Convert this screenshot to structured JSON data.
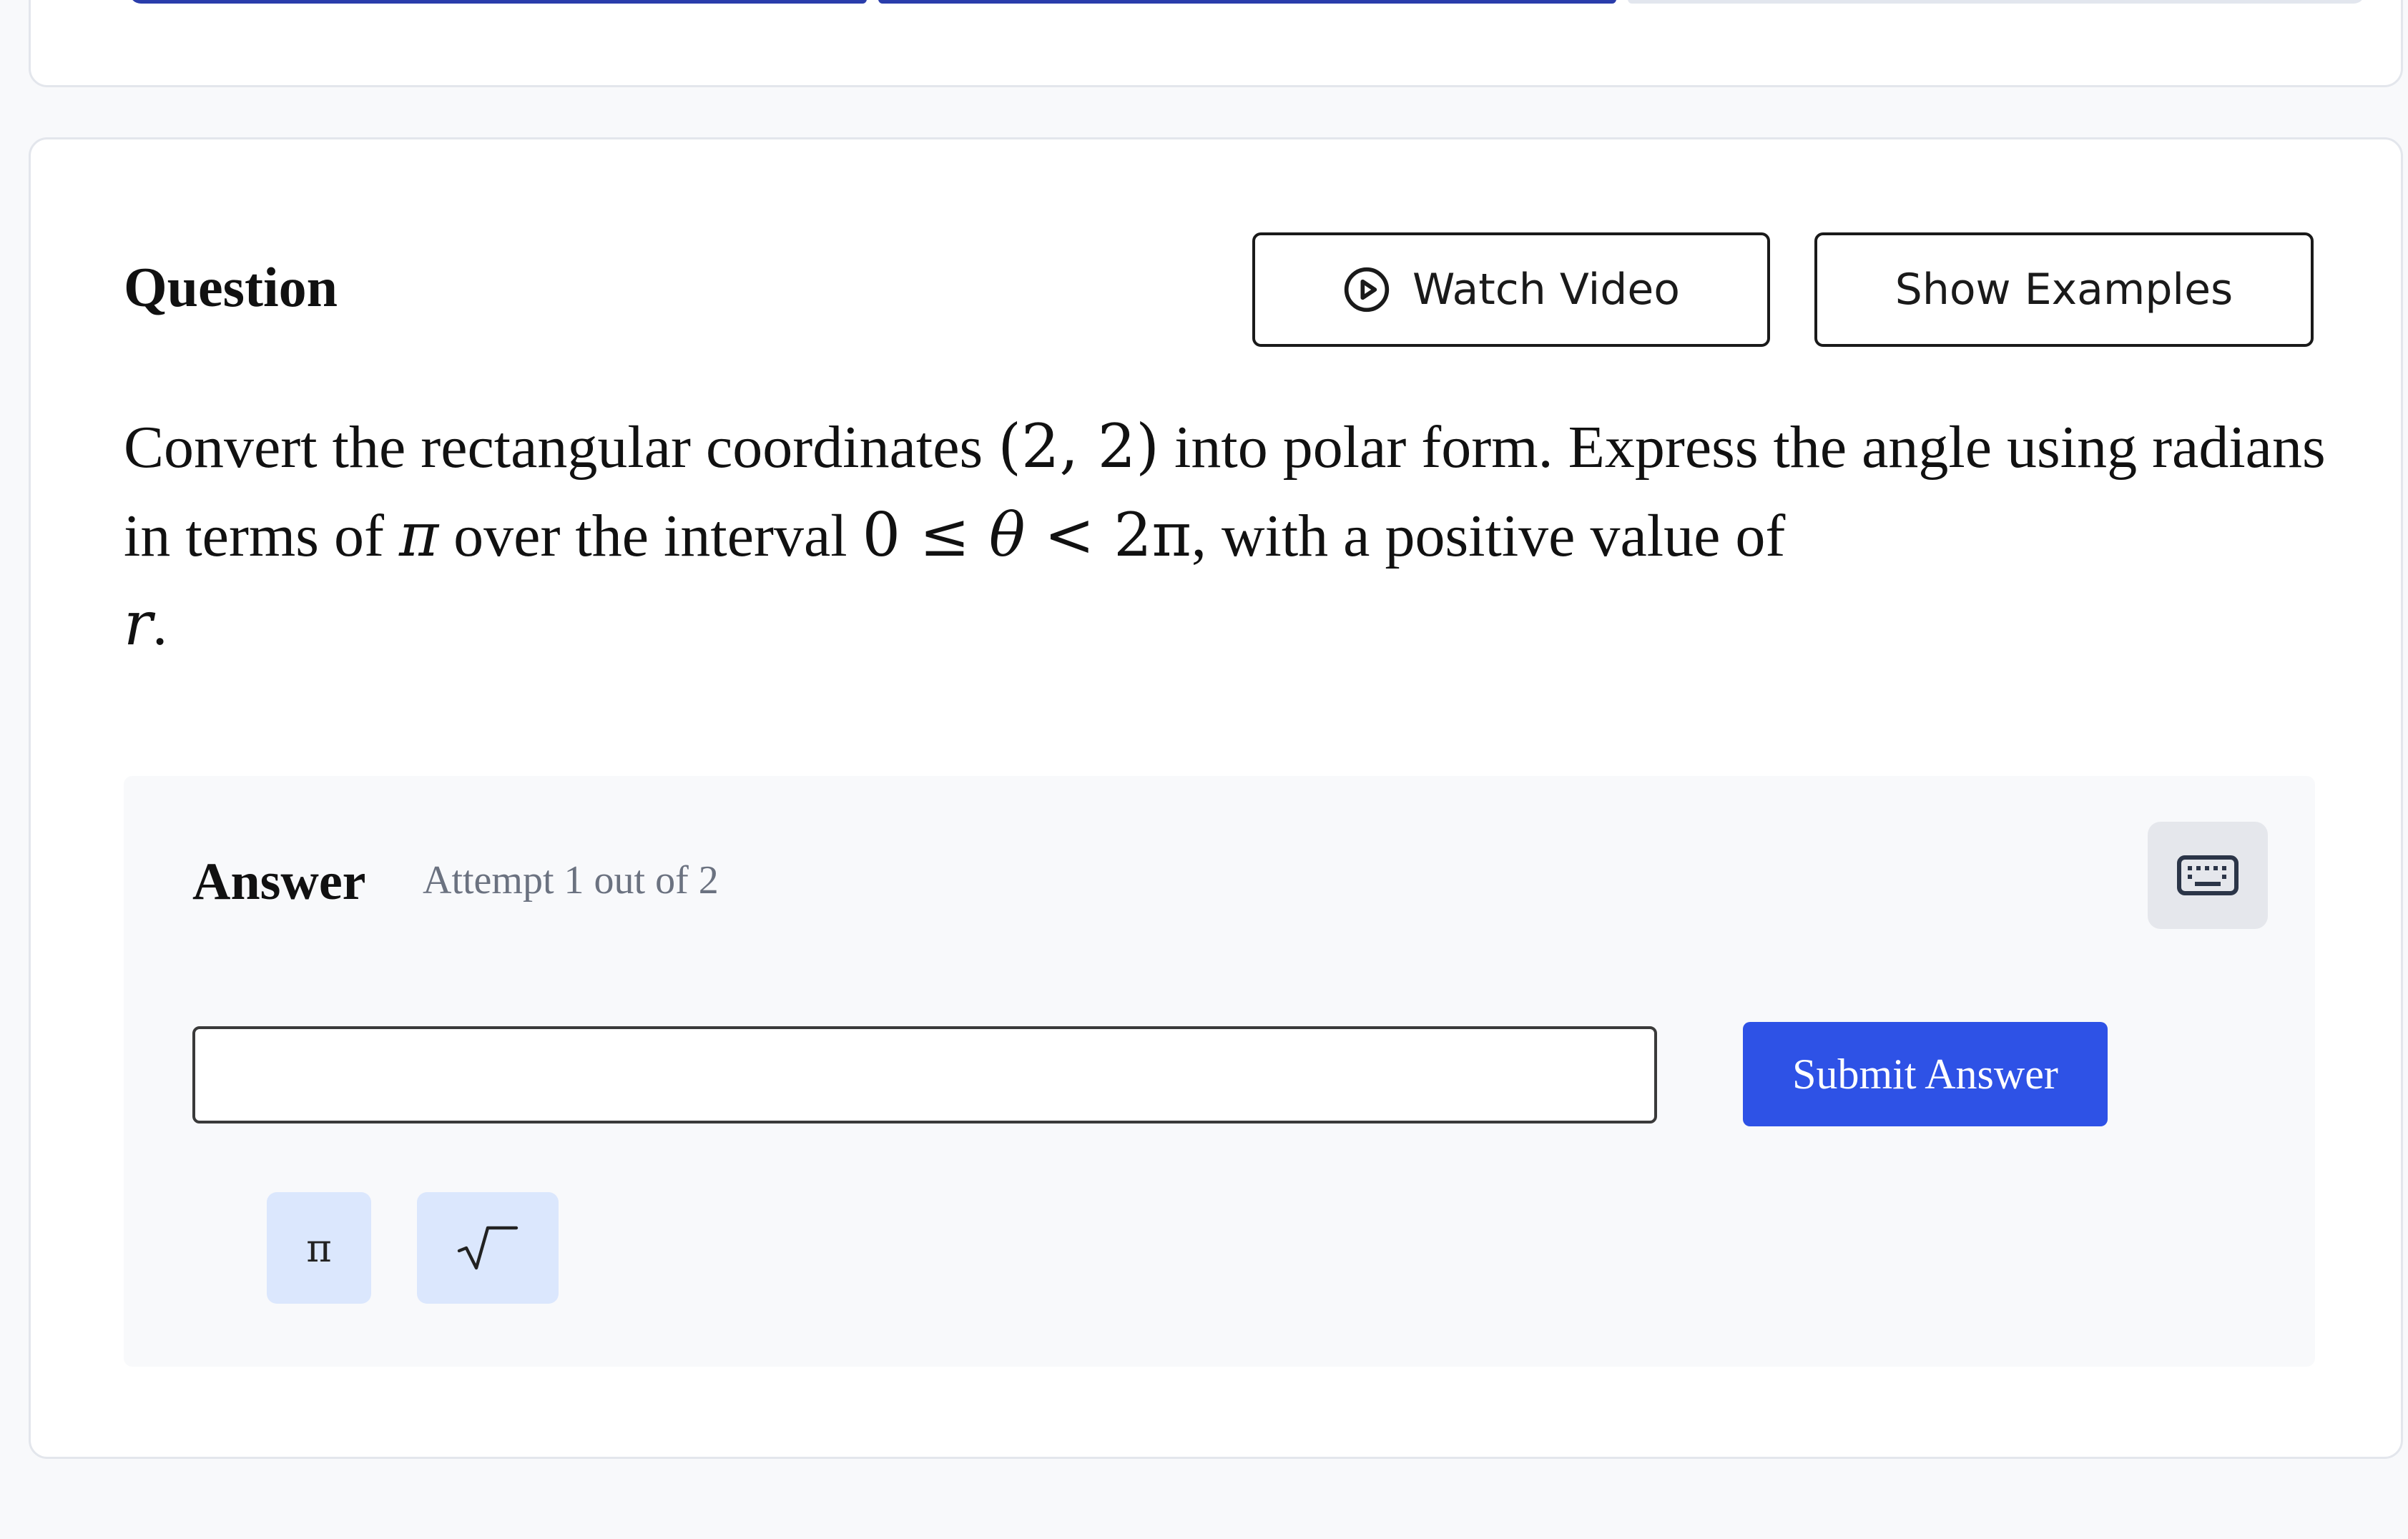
{
  "progress": {
    "segments": [
      {
        "fill": 1.0
      },
      {
        "fill": 1.0
      },
      {
        "fill": 0.0
      }
    ],
    "colors": {
      "filled": "#2a3dab",
      "empty": "#e2e6ee"
    }
  },
  "question": {
    "title": "Question",
    "watch_video_label": "Watch Video",
    "show_examples_label": "Show Examples",
    "text_part1": "Convert the rectangular coordinates ",
    "coords": "(2,  2)",
    "text_part2": " into polar form. Express the angle using radians in terms of ",
    "pi": "π",
    "text_part3": " over the interval ",
    "interval_start": "0 ≤ ",
    "theta": "θ",
    "interval_end": " < 2π",
    "text_part4": ", with a positive value of ",
    "r_var": "r",
    "text_end": "."
  },
  "answer": {
    "title": "Answer",
    "attempt": "Attempt 1 out of 2",
    "input_value": "",
    "input_placeholder": "",
    "submit_label": "Submit Answer",
    "symbol_buttons": [
      {
        "label": "π",
        "icon": "pi-symbol"
      },
      {
        "label": "√",
        "icon": "square-root-icon"
      }
    ],
    "keyboard_icon": "keyboard-icon"
  },
  "colors": {
    "accent": "#2e52e6",
    "progress": "#2a3dab",
    "symbol_button_bg": "#dbe7fd",
    "muted_text": "#6b7280"
  }
}
